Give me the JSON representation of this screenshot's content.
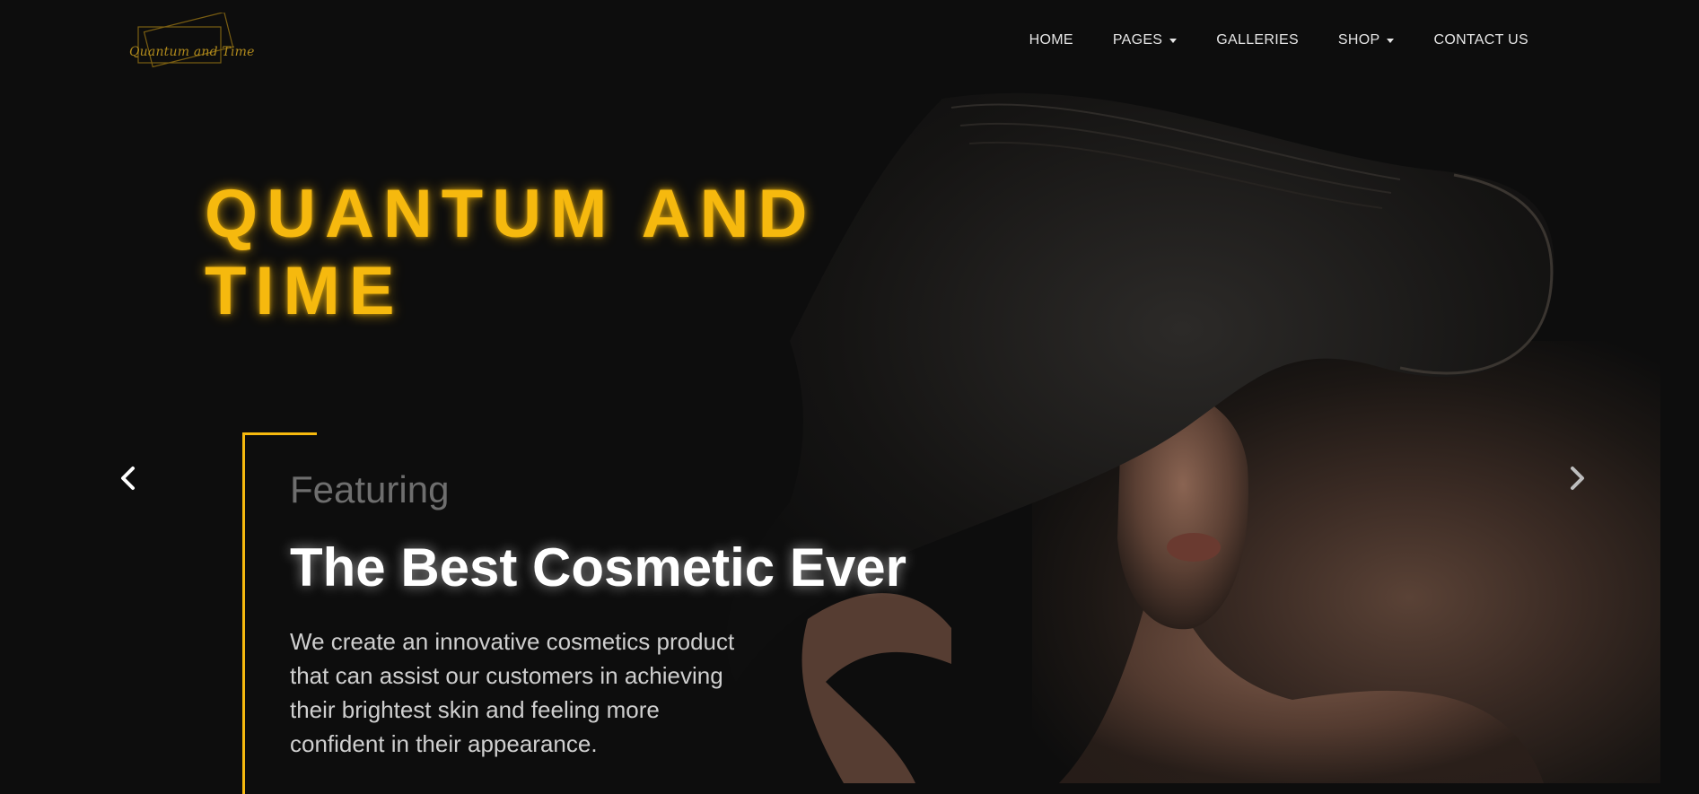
{
  "logo": {
    "text": "Quantum and Time"
  },
  "nav": {
    "items": [
      {
        "label": "HOME",
        "dropdown": false
      },
      {
        "label": "PAGES",
        "dropdown": true
      },
      {
        "label": "GALLERIES",
        "dropdown": false
      },
      {
        "label": "SHOP",
        "dropdown": true
      },
      {
        "label": "CONTACT US",
        "dropdown": false
      }
    ]
  },
  "hero": {
    "title": "QUANTUM AND TIME",
    "eyebrow": "Featuring",
    "headline": "The Best Cosmetic Ever",
    "body": "We create an innovative cosmetics product that can assist our customers in achieving their brightest skin and feeling more confident in their appearance."
  },
  "carousel": {
    "prev_icon": "chevron-left-icon",
    "next_icon": "chevron-right-icon"
  },
  "colors": {
    "accent": "#f6b90e",
    "background": "#0d0d0d",
    "text": "#ffffff"
  }
}
